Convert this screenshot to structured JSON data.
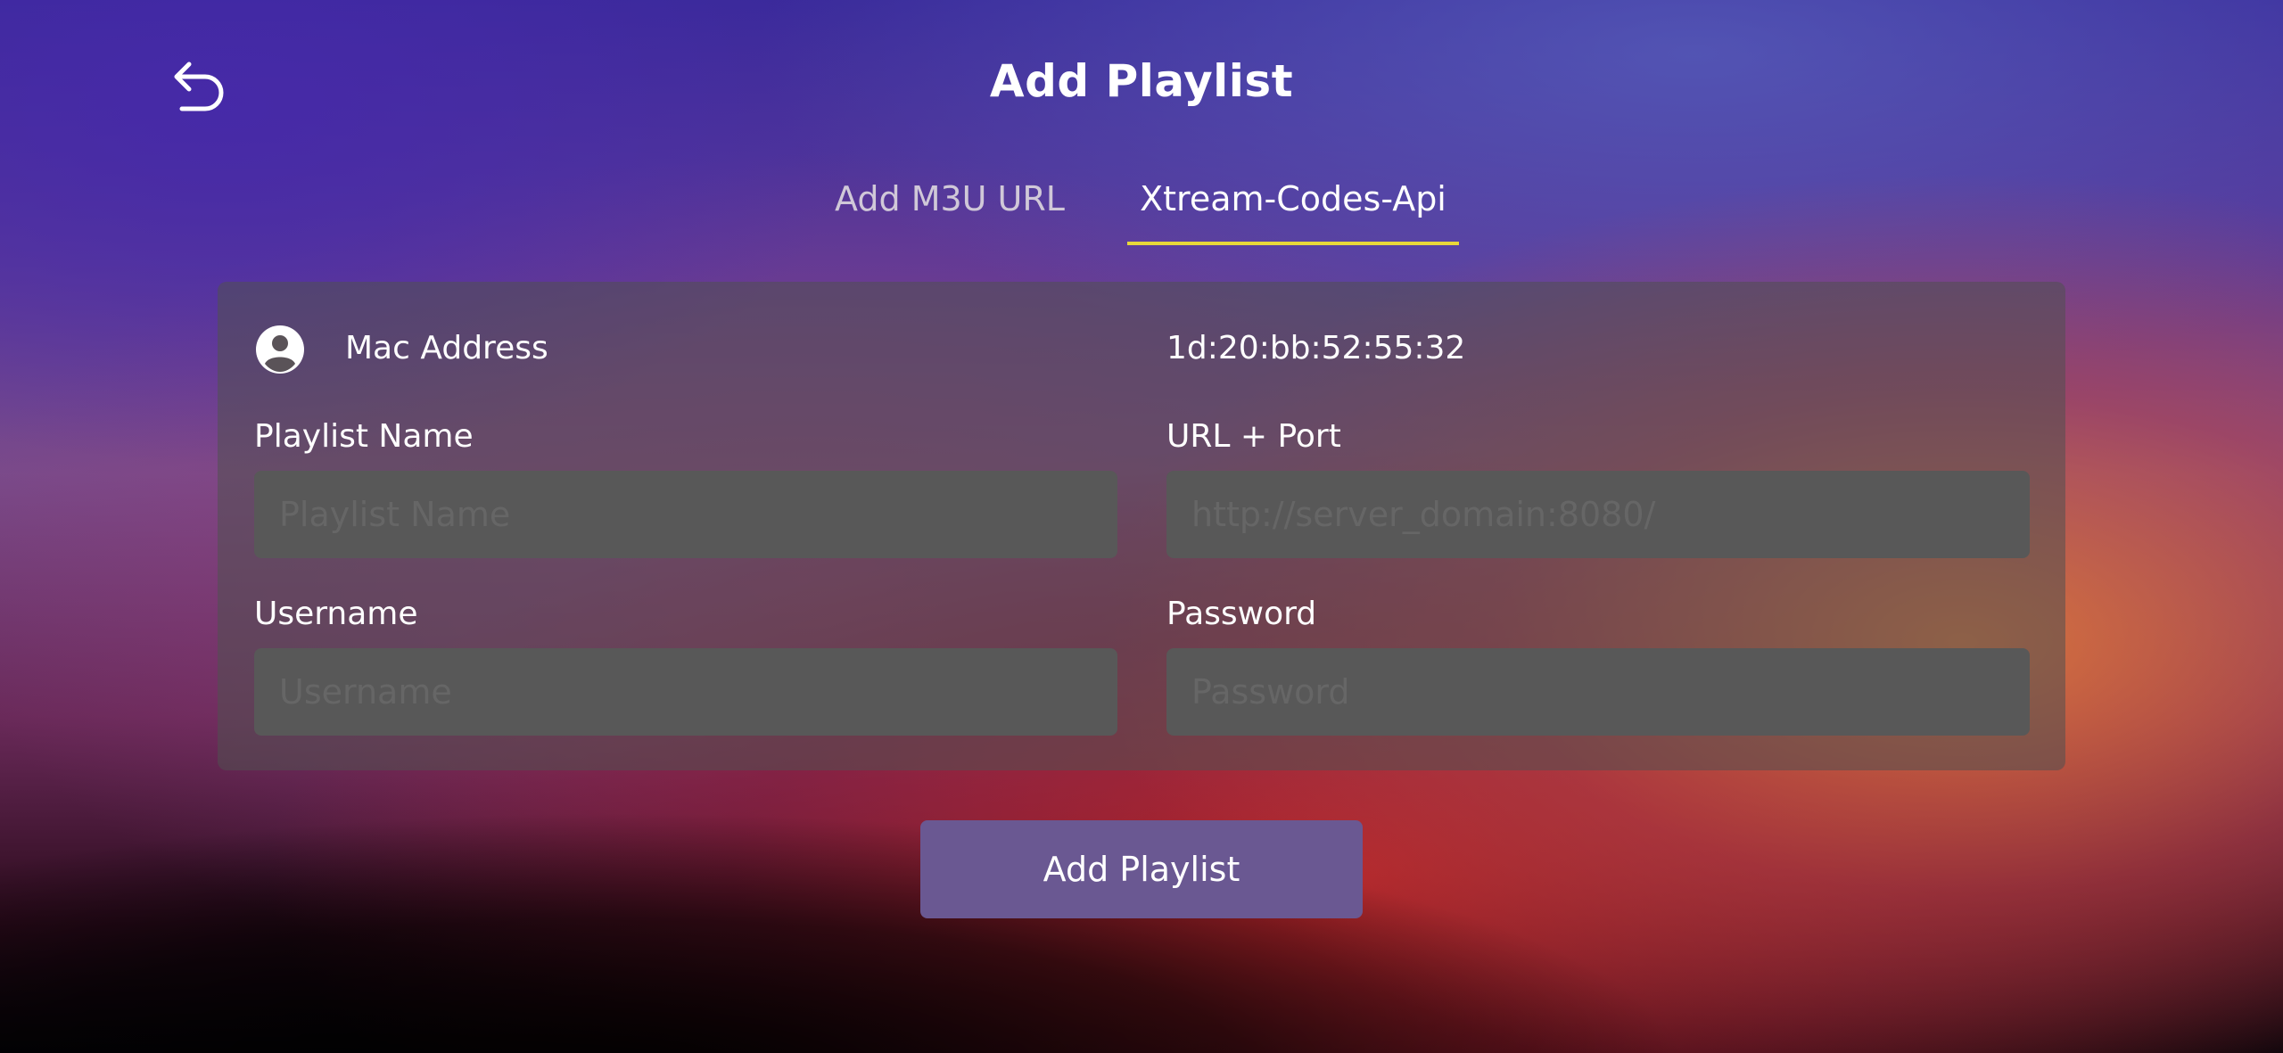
{
  "header": {
    "title": "Add Playlist",
    "back_icon": "back-arrow-icon"
  },
  "tabs": [
    {
      "label": "Add M3U URL",
      "active": false
    },
    {
      "label": "Xtream-Codes-Api",
      "active": true
    }
  ],
  "tab_indicator_color": "#e8d83a",
  "mac": {
    "icon": "user-circle-icon",
    "label": "Mac Address",
    "value": "1d:20:bb:52:55:32"
  },
  "fields": {
    "playlist_name": {
      "label": "Playlist Name",
      "placeholder": "Playlist Name",
      "value": ""
    },
    "url_port": {
      "label": "URL + Port",
      "placeholder": "http://server_domain:8080/",
      "value": ""
    },
    "username": {
      "label": "Username",
      "placeholder": "Username",
      "value": ""
    },
    "password": {
      "label": "Password",
      "placeholder": "Password",
      "value": ""
    }
  },
  "submit": {
    "label": "Add Playlist",
    "color": "#6a5892"
  }
}
